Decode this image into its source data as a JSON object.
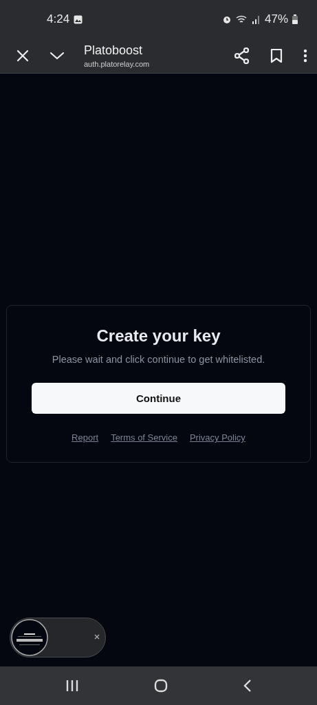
{
  "status_bar": {
    "time": "4:24",
    "battery": "47%"
  },
  "browser_toolbar": {
    "title": "Platoboost",
    "url": "auth.platorelay.com"
  },
  "card": {
    "title": "Create your key",
    "subtitle": "Please wait and click continue to get whitelisted.",
    "button": "Continue",
    "links": [
      "Report",
      "Terms of Service",
      "Privacy Policy"
    ]
  }
}
